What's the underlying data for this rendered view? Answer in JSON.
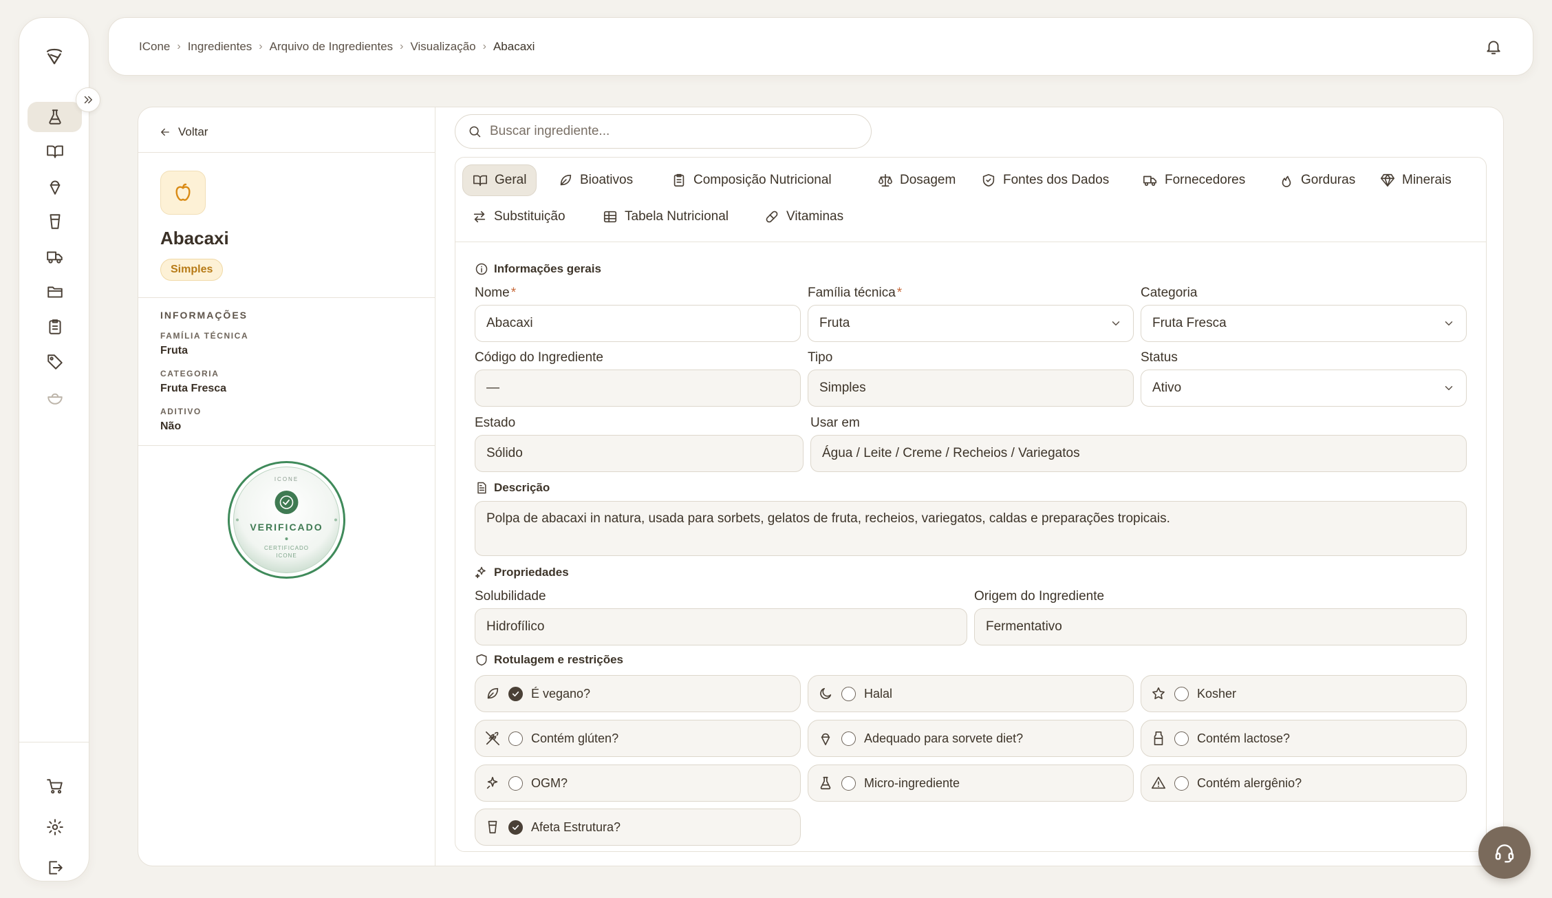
{
  "breadcrumb": [
    "ICone",
    "Ingredientes",
    "Arquivo de Ingredientes",
    "Visualização",
    "Abacaxi"
  ],
  "back_label": "Voltar",
  "ingredient": {
    "name": "Abacaxi",
    "badge": "Simples"
  },
  "info": {
    "heading": "INFORMAÇÕES",
    "familia_label": "FAMÍLIA TÉCNICA",
    "familia_value": "Fruta",
    "categoria_label": "CATEGORIA",
    "categoria_value": "Fruta Fresca",
    "aditivo_label": "ADITIVO",
    "aditivo_value": "Não"
  },
  "seal": {
    "top": "ICONE",
    "main": "VERIFICADO",
    "bottom1": "CERTIFICADO",
    "bottom2": "ICONE",
    "color": "#3f8a5a"
  },
  "search": {
    "placeholder": "Buscar ingrediente..."
  },
  "tabs": [
    {
      "label": "Geral",
      "icon": "book-icon"
    },
    {
      "label": "Bioativos",
      "icon": "leaf-icon"
    },
    {
      "label": "Composição Nutricional",
      "icon": "clipboard-icon"
    },
    {
      "label": "Dosagem",
      "icon": "scale-icon"
    },
    {
      "label": "Fontes dos Dados",
      "icon": "shield-check-icon"
    },
    {
      "label": "Fornecedores",
      "icon": "truck-icon"
    },
    {
      "label": "Gorduras",
      "icon": "flame-icon"
    },
    {
      "label": "Minerais",
      "icon": "gem-icon"
    },
    {
      "label": "Substituição",
      "icon": "swap-icon"
    },
    {
      "label": "Tabela Nutricional",
      "icon": "table-icon"
    },
    {
      "label": "Vitaminas",
      "icon": "pill-icon"
    }
  ],
  "sections": {
    "geral": "Informações gerais",
    "descricao": "Descrição",
    "propriedades": "Propriedades",
    "rotulagem": "Rotulagem e restrições"
  },
  "fields": {
    "nome": {
      "label": "Nome",
      "value": "Abacaxi"
    },
    "familia": {
      "label": "Família técnica",
      "value": "Fruta"
    },
    "categoria": {
      "label": "Categoria",
      "value": "Fruta Fresca"
    },
    "codigo": {
      "label": "Código do Ingrediente",
      "value": "—"
    },
    "tipo": {
      "label": "Tipo",
      "value": "Simples"
    },
    "status": {
      "label": "Status",
      "value": "Ativo"
    },
    "estado": {
      "label": "Estado",
      "value": "Sólido"
    },
    "usar_em": {
      "label": "Usar em",
      "value": "Água / Leite / Creme / Recheios / Variegatos"
    },
    "descricao": "Polpa de abacaxi in natura, usada para sorbets, gelatos de fruta, recheios, variegatos, caldas e preparações tropicais.",
    "solubilidade": {
      "label": "Solubilidade",
      "value": "Hidrofílico"
    },
    "origem": {
      "label": "Origem do Ingrediente",
      "value": "Fermentativo"
    }
  },
  "required_mark": "*",
  "flags": [
    {
      "label": "É vegano?",
      "checked": true,
      "icon": "leaf-icon"
    },
    {
      "label": "Halal",
      "checked": false,
      "icon": "moon-icon"
    },
    {
      "label": "Kosher",
      "checked": false,
      "icon": "star-icon"
    },
    {
      "label": "Contém glúten?",
      "checked": false,
      "icon": "wheat-icon"
    },
    {
      "label": "Adequado para sorvete diet?",
      "checked": false,
      "icon": "ice-cream-icon"
    },
    {
      "label": "Contém lactose?",
      "checked": false,
      "icon": "milk-icon"
    },
    {
      "label": "OGM?",
      "checked": false,
      "icon": "sparkle-icon"
    },
    {
      "label": "Micro-ingrediente",
      "checked": false,
      "icon": "flask-icon"
    },
    {
      "label": "Contém alergênio?",
      "checked": false,
      "icon": "warning-icon"
    },
    {
      "label": "Afeta Estrutura?",
      "checked": true,
      "icon": "cup-icon"
    }
  ]
}
